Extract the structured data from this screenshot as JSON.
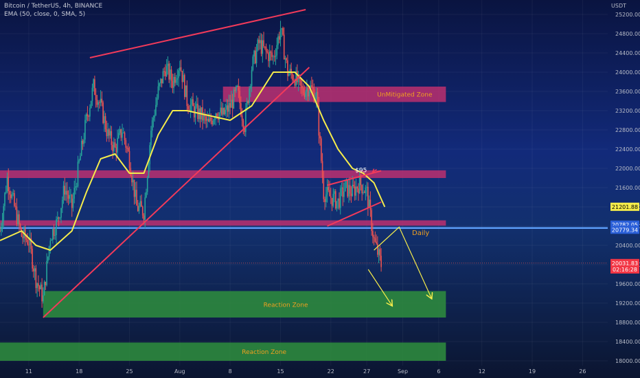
{
  "header": {
    "symbol_line": "Bitcoin / TetherUS, 4h, BINANCE",
    "indicator_line": "EMA (50, close, 0, SMA, 5)",
    "currency": "USDT"
  },
  "colors": {
    "up": "#26a69a",
    "down": "#ef5350",
    "ema": "#f5ec4b",
    "trendline": "#f23a5a",
    "supply_zone": "#c2306f",
    "demand_zone": "#2e8b3e",
    "daily_line": "#5b9bf5",
    "arrow": "#f5ec4b",
    "zone_label": "#f0a020"
  },
  "chart_data": {
    "type": "candlestick",
    "symbol": "Bitcoin / TetherUS",
    "timeframe": "4h",
    "exchange": "BINANCE",
    "indicator": "EMA (50, close, 0, SMA, 5)",
    "ylim": [
      17900,
      25500
    ],
    "y_ticks": [
      18000,
      18400,
      18800,
      19200,
      19600,
      20000,
      20400,
      20800,
      21200,
      21600,
      22000,
      22400,
      22800,
      23200,
      23600,
      24000,
      24400,
      24800,
      25200
    ],
    "y_tick_labels": [
      "18000.00",
      "18400.00",
      "18800.00",
      "19200.00",
      "19600.00",
      "20000.00",
      "20400.00",
      "20800.00",
      "21200.00",
      "21600.00",
      "22000.00",
      "22400.00",
      "22800.00",
      "23200.00",
      "23600.00",
      "24000.00",
      "24400.00",
      "24800.00",
      "25200.00"
    ],
    "x_ticks": [
      {
        "label": "11",
        "day": 11
      },
      {
        "label": "18",
        "day": 18
      },
      {
        "label": "25",
        "day": 25
      },
      {
        "label": "Aug",
        "day": 32
      },
      {
        "label": "8",
        "day": 39
      },
      {
        "label": "15",
        "day": 46
      },
      {
        "label": "22",
        "day": 53
      },
      {
        "label": "27",
        "day": 58
      },
      {
        "label": "Sep",
        "day": 63
      },
      {
        "label": "6",
        "day": 68
      },
      {
        "label": "12",
        "day": 74
      },
      {
        "label": "19",
        "day": 81
      },
      {
        "label": "26",
        "day": 88
      }
    ],
    "price_path": [
      {
        "day": 7.0,
        "price": 20700
      },
      {
        "day": 8.0,
        "price": 21800
      },
      {
        "day": 9.0,
        "price": 21200
      },
      {
        "day": 10.0,
        "price": 20600
      },
      {
        "day": 11.0,
        "price": 20500
      },
      {
        "day": 12.0,
        "price": 19700
      },
      {
        "day": 13.0,
        "price": 19300
      },
      {
        "day": 14.0,
        "price": 20600
      },
      {
        "day": 15.0,
        "price": 20900
      },
      {
        "day": 16.0,
        "price": 21600
      },
      {
        "day": 17.0,
        "price": 21200
      },
      {
        "day": 18.0,
        "price": 22100
      },
      {
        "day": 19.0,
        "price": 23000
      },
      {
        "day": 20.0,
        "price": 23700
      },
      {
        "day": 21.0,
        "price": 23300
      },
      {
        "day": 22.0,
        "price": 22700
      },
      {
        "day": 23.0,
        "price": 22400
      },
      {
        "day": 24.0,
        "price": 22800
      },
      {
        "day": 25.0,
        "price": 22200
      },
      {
        "day": 26.0,
        "price": 21200
      },
      {
        "day": 27.0,
        "price": 21100
      },
      {
        "day": 28.0,
        "price": 22800
      },
      {
        "day": 29.0,
        "price": 23600
      },
      {
        "day": 30.0,
        "price": 24100
      },
      {
        "day": 31.0,
        "price": 23800
      },
      {
        "day": 32.0,
        "price": 24200
      },
      {
        "day": 33.0,
        "price": 23400
      },
      {
        "day": 34.0,
        "price": 23200
      },
      {
        "day": 35.0,
        "price": 23100
      },
      {
        "day": 36.0,
        "price": 22900
      },
      {
        "day": 37.0,
        "price": 23200
      },
      {
        "day": 38.0,
        "price": 23100
      },
      {
        "day": 39.0,
        "price": 23300
      },
      {
        "day": 40.0,
        "price": 23600
      },
      {
        "day": 41.0,
        "price": 22900
      },
      {
        "day": 42.0,
        "price": 24100
      },
      {
        "day": 43.0,
        "price": 24600
      },
      {
        "day": 44.0,
        "price": 24400
      },
      {
        "day": 45.0,
        "price": 24300
      },
      {
        "day": 46.0,
        "price": 24900
      },
      {
        "day": 47.0,
        "price": 24000
      },
      {
        "day": 48.0,
        "price": 23900
      },
      {
        "day": 49.0,
        "price": 23600
      },
      {
        "day": 50.0,
        "price": 23700
      },
      {
        "day": 51.0,
        "price": 23500
      },
      {
        "day": 52.0,
        "price": 21500
      },
      {
        "day": 53.0,
        "price": 21400
      },
      {
        "day": 54.0,
        "price": 21300
      },
      {
        "day": 55.0,
        "price": 21600
      },
      {
        "day": 56.0,
        "price": 21500
      },
      {
        "day": 57.0,
        "price": 21700
      },
      {
        "day": 58.0,
        "price": 21500
      },
      {
        "day": 59.0,
        "price": 20500
      },
      {
        "day": 60.0,
        "price": 20000
      }
    ],
    "ema_path": [
      {
        "day": 7.0,
        "price": 20500
      },
      {
        "day": 10.0,
        "price": 20700
      },
      {
        "day": 12.0,
        "price": 20400
      },
      {
        "day": 14.0,
        "price": 20300
      },
      {
        "day": 17.0,
        "price": 20700
      },
      {
        "day": 19.0,
        "price": 21500
      },
      {
        "day": 21.0,
        "price": 22200
      },
      {
        "day": 23.0,
        "price": 22300
      },
      {
        "day": 25.0,
        "price": 21900
      },
      {
        "day": 27.0,
        "price": 21900
      },
      {
        "day": 29.0,
        "price": 22700
      },
      {
        "day": 31.0,
        "price": 23200
      },
      {
        "day": 33.0,
        "price": 23200
      },
      {
        "day": 36.0,
        "price": 23100
      },
      {
        "day": 39.0,
        "price": 23000
      },
      {
        "day": 42.0,
        "price": 23300
      },
      {
        "day": 45.0,
        "price": 24000
      },
      {
        "day": 48.0,
        "price": 24000
      },
      {
        "day": 50.0,
        "price": 23700
      },
      {
        "day": 52.0,
        "price": 23000
      },
      {
        "day": 54.0,
        "price": 22400
      },
      {
        "day": 56.0,
        "price": 22000
      },
      {
        "day": 57.5,
        "price": 21900
      },
      {
        "day": 59.0,
        "price": 21700
      },
      {
        "day": 60.5,
        "price": 21200
      }
    ],
    "zones": [
      {
        "kind": "supply",
        "label": "UnMitigated Zone",
        "day_from": 38,
        "day_to": 69,
        "price_from": 23380,
        "price_to": 23700
      },
      {
        "kind": "supply",
        "label": "",
        "day_from": 7,
        "day_to": 69,
        "price_from": 21800,
        "price_to": 21960
      },
      {
        "kind": "supply",
        "label": "",
        "day_from": 7,
        "day_to": 69,
        "price_from": 20810,
        "price_to": 20920
      },
      {
        "kind": "demand",
        "label": "Reaction Zone",
        "day_from": 13,
        "day_to": 69,
        "price_from": 18900,
        "price_to": 19450
      },
      {
        "kind": "demand",
        "label": "Reaction Zone",
        "day_from": 7,
        "day_to": 69,
        "price_from": 18000,
        "price_to": 18380
      }
    ],
    "daily_level": {
      "label": "Daily",
      "price": 20760
    },
    "trendlines": [
      {
        "from_day": 19.5,
        "from_price": 24300,
        "to_day": 49.5,
        "to_price": 25300
      },
      {
        "from_day": 13.0,
        "from_price": 18900,
        "to_day": 50.0,
        "to_price": 24100
      },
      {
        "from_day": 52.5,
        "from_price": 21650,
        "to_day": 60.0,
        "to_price": 21950
      },
      {
        "from_day": 52.5,
        "from_price": 20800,
        "to_day": 60.0,
        "to_price": 21300
      }
    ],
    "projection": [
      {
        "day": 59.0,
        "price": 20300
      },
      {
        "day": 62.5,
        "price": 20780
      },
      {
        "day": 67.0,
        "price": 19300
      }
    ],
    "projection2": [
      {
        "day": 58.2,
        "price": 19900
      },
      {
        "day": 61.5,
        "price": 19150
      }
    ],
    "annotations": [
      {
        "text": "$95",
        "day": 57.2,
        "price": 21920
      }
    ],
    "price_labels": [
      {
        "text": "21201.88",
        "price": 21201.88,
        "bg": "#f5ec4b",
        "fg": "#000000"
      },
      {
        "text": "20782.05",
        "price": 20830,
        "bg": "#2a5fd8",
        "fg": "#ffffff"
      },
      {
        "text": "20779.34",
        "price": 20725,
        "bg": "#2a5fd8",
        "fg": "#ffffff"
      },
      {
        "text": "20031.83",
        "price": 20031.83,
        "bg": "#f23645",
        "fg": "#ffffff"
      },
      {
        "text": "02:16:28",
        "price": 19900,
        "bg": "#f23645",
        "fg": "#ffffff"
      }
    ],
    "current_price": 20031.83
  }
}
